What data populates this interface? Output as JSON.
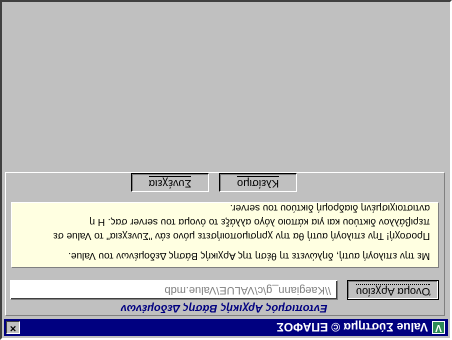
{
  "window": {
    "title": "Value Σύστημα © ΕΠΑΦΟΣ",
    "app_icon_glyph": "V",
    "close_glyph": "×"
  },
  "section": {
    "title": "Εντοπισμός Αρχικής Βάσης Δεδομένων"
  },
  "file_button": {
    "label": "Όνομα Αρχείου"
  },
  "path_field": {
    "value": "\\\\Kaegiann_g\\c\\VALUE\\Value.mdb"
  },
  "info": {
    "paragraph1": "Με την επιλογή αυτή, δηλώνετε τη θέση της Αρχικής Βάσης Δεδομένων του Value.",
    "paragraph2": "Προσοχή! Την επιλογή αυτή θα την χρησιμοποιήσετε μόνο εάν \"Συνεχεια\" το Value σε περιβάλλον δικτύου και για κάποιο λόγο αλλάξε το όνομα του server σας. Η η αντιστοιχισμένη διαδρομή δικτύου του server."
  },
  "buttons": {
    "cancel": "Κλείσιμο",
    "continue": "Συνέχεια"
  },
  "colors": {
    "titlebar": "#000080",
    "face": "#c0c0c0",
    "info_bg": "#ffffe1",
    "section_title": "#000080"
  }
}
